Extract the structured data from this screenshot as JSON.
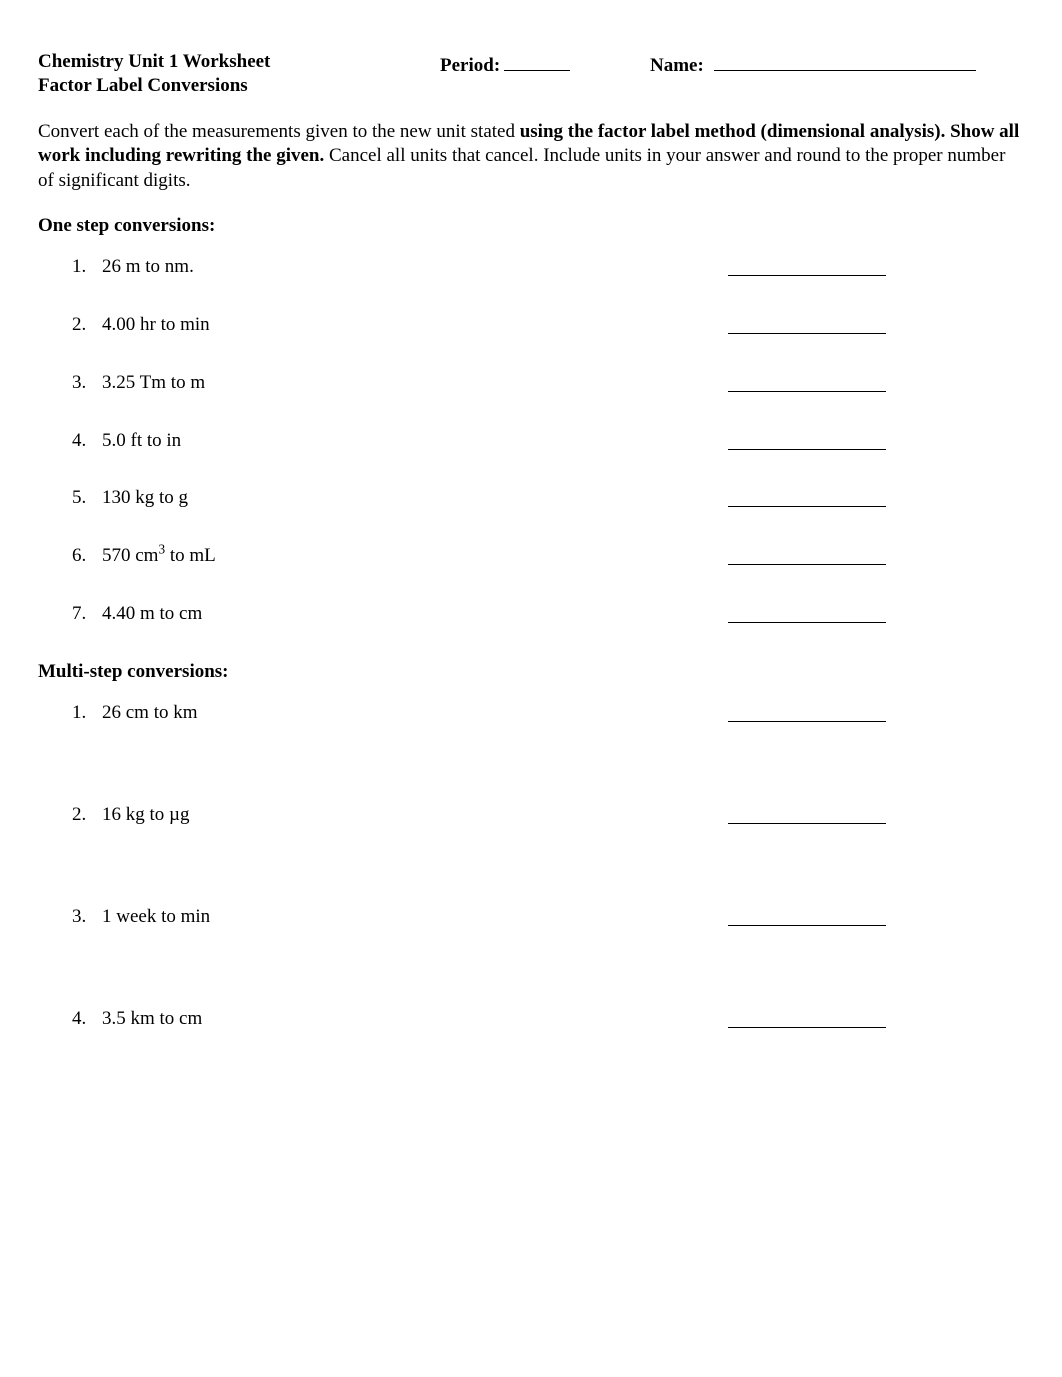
{
  "header": {
    "title_line1": "Chemistry Unit 1 Worksheet",
    "title_line2": "Factor Label Conversions",
    "period_label": "Period:",
    "name_label": "Name:"
  },
  "instructions": {
    "part1": "Convert each of the measurements given to the new unit stated ",
    "bold1": "using the factor label method (dimensional analysis).  Show all work including rewriting the given.",
    "part2": " Cancel all units that cancel. Include units in your answer and round to the proper number of significant digits."
  },
  "sections": [
    {
      "heading": "One step conversions:",
      "gap": "normal",
      "items": [
        {
          "num": "1.",
          "text": "26 m to nm."
        },
        {
          "num": "2.",
          "text": " 4.00 hr to min"
        },
        {
          "num": "3.",
          "text": "3.25 Tm to m"
        },
        {
          "num": "4.",
          "text": "5.0 ft to in"
        },
        {
          "num": "5.",
          "text": "130 kg to g"
        },
        {
          "num": "6.",
          "text_html": "570 cm<sup>3</sup> to mL"
        },
        {
          "num": "7.",
          "text": "4.40 m to cm"
        }
      ]
    },
    {
      "heading": "Multi-step conversions:",
      "gap": "large",
      "items": [
        {
          "num": "1.",
          "text": "26 cm to km"
        },
        {
          "num": "2.",
          "text": "16 kg to µg"
        },
        {
          "num": "3.",
          "text": "1 week to min"
        },
        {
          "num": "4.",
          "text": "3.5 km to cm"
        }
      ]
    }
  ]
}
